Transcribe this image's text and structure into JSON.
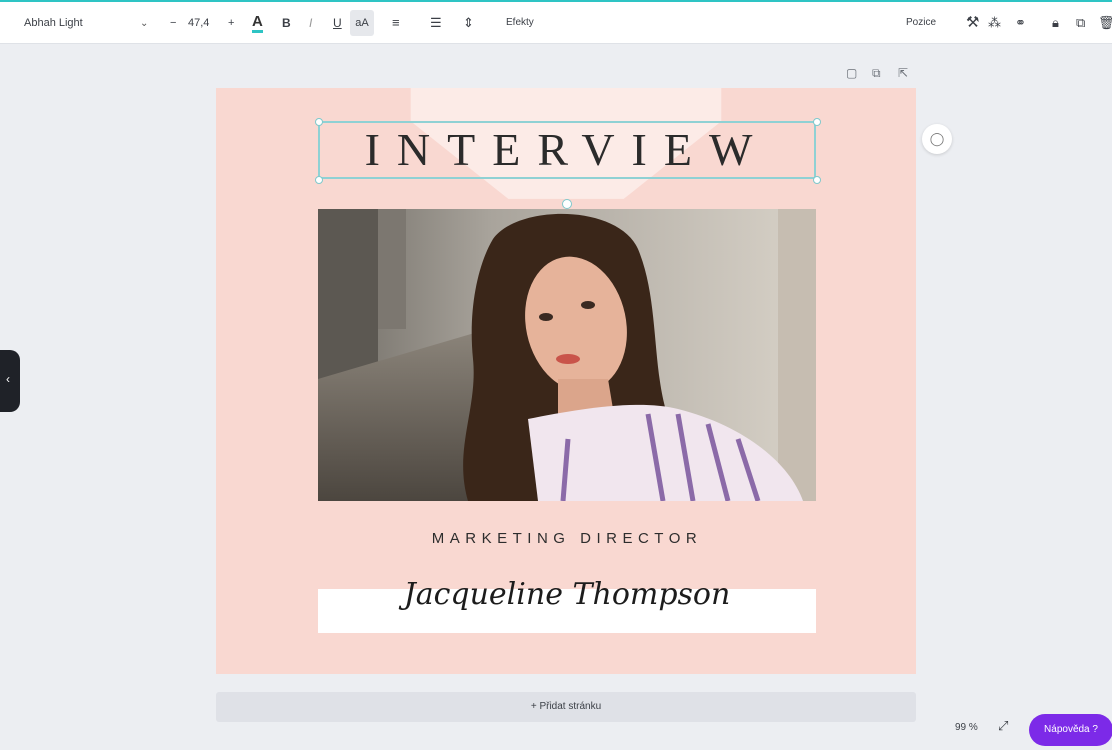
{
  "toolbar": {
    "font_name": "Abhah Light",
    "font_size": "47,4",
    "bold_label": "B",
    "italic_label": "I",
    "underline_label": "U",
    "case_label": "aA",
    "effects_label": "Efekty",
    "position_label": "Pozice"
  },
  "design": {
    "title": "INTERVIEW",
    "role": "MARKETING DIRECTOR",
    "name": "Jacqueline Thompson"
  },
  "add_page_label": "+ Přidat stránku",
  "zoom": "99 %",
  "help_label": "Nápověda ?",
  "colors": {
    "accent": "#7c2ae8",
    "page_bg": "#f9d8d1",
    "selection": "#8fd1d4"
  }
}
